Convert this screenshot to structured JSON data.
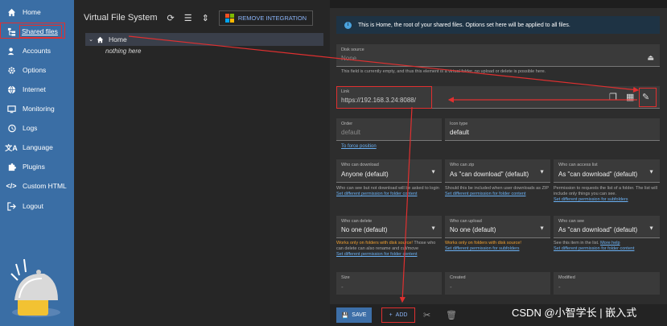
{
  "sidebar": {
    "items": [
      {
        "label": "Home",
        "icon": "home-icon"
      },
      {
        "label": "Shared files",
        "icon": "shared-files-icon"
      },
      {
        "label": "Accounts",
        "icon": "accounts-icon"
      },
      {
        "label": "Options",
        "icon": "gear-icon"
      },
      {
        "label": "Internet",
        "icon": "globe-icon"
      },
      {
        "label": "Monitoring",
        "icon": "monitor-icon"
      },
      {
        "label": "Logs",
        "icon": "history-icon"
      },
      {
        "label": "Language",
        "icon": "translate-icon"
      },
      {
        "label": "Plugins",
        "icon": "puzzle-icon"
      },
      {
        "label": "Custom HTML",
        "icon": "code-icon"
      },
      {
        "label": "Logout",
        "icon": "logout-icon"
      }
    ]
  },
  "tree": {
    "title": "Virtual File System",
    "remove_integration": "REMOVE INTEGRATION",
    "root_label": "Home",
    "empty_text": "nothing here"
  },
  "form": {
    "info": "This is Home, the root of your shared files. Options set here will be applied to all files.",
    "disk_source": {
      "label": "Disk source",
      "placeholder": "None"
    },
    "disk_help": "This field is currently empty, and thus this element is a virtual folder, no upload or delete is possible here.",
    "link": {
      "label": "Link",
      "value": "https://192.168.3.24:8088/"
    },
    "order": {
      "label": "Order",
      "value": "default"
    },
    "order_link": "To force position",
    "icon_type": {
      "label": "Icon type",
      "value": "default"
    },
    "who_download": {
      "label": "Who can download",
      "value": "Anyone (default)"
    },
    "who_download_help": "Who can see but not download will be asked to login",
    "who_download_link": "Set different permission for folder content",
    "who_zip": {
      "label": "Who can zip",
      "value": "As \"can download\" (default)"
    },
    "who_zip_help": "Should this be included when user downloads as ZIP",
    "who_zip_link": "Set different permission for folder content",
    "who_access": {
      "label": "Who can access list",
      "value": "As \"can download\" (default)"
    },
    "who_access_help": "Permission to requests the list of a folder. The list will include only things you can see.",
    "who_access_link": "Set different permission for subfolders",
    "who_delete": {
      "label": "Who can delete",
      "value": "No one (default)"
    },
    "who_delete_warn": "Works only on folders with disk source!",
    "who_delete_help": "Those who can delete can also rename and cut/move",
    "who_delete_link": "Set different permission for folder content",
    "who_upload": {
      "label": "Who can upload",
      "value": "No one (default)"
    },
    "who_upload_warn": "Works only on folders with disk source!",
    "who_upload_link": "Set different permission for subfolders",
    "who_see": {
      "label": "Who can see",
      "value": "As \"can download\" (default)"
    },
    "who_see_help": "See this item in the list.",
    "who_see_more": "More help",
    "who_see_link": "Set different permission for folder content",
    "size": {
      "label": "Size",
      "value": "-"
    },
    "created": {
      "label": "Created",
      "value": "-"
    },
    "modified": {
      "label": "Modified",
      "value": "-"
    }
  },
  "footer": {
    "save": "SAVE",
    "add": "ADD"
  },
  "watermark": "CSDN @小智学长 | 嵌入式",
  "colors": {
    "sidebar": "#3a6ea5",
    "annotation": "#e03030",
    "accent": "#6ab0f3"
  }
}
